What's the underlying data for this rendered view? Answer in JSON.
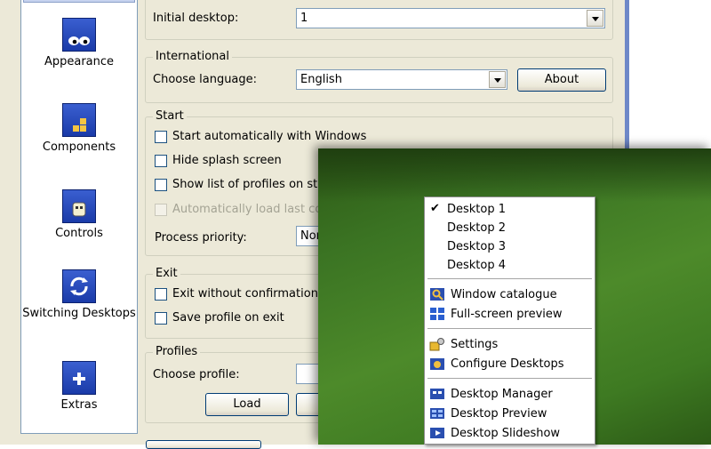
{
  "sidebar": {
    "items": [
      {
        "label": "Appearance",
        "icon": "appearance-icon"
      },
      {
        "label": "Components",
        "icon": "components-icon"
      },
      {
        "label": "Controls",
        "icon": "controls-icon"
      },
      {
        "label": "Switching Desktops",
        "icon": "switching-icon"
      },
      {
        "label": "Extras",
        "icon": "extras-icon"
      }
    ]
  },
  "desktop": {
    "initial_label": "Initial desktop:",
    "initial_value": "1"
  },
  "international": {
    "legend": "International",
    "language_label": "Choose language:",
    "language_value": "English",
    "about_button": "About"
  },
  "start": {
    "legend": "Start",
    "options": [
      {
        "label": "Start automatically with Windows",
        "checked": false,
        "enabled": true
      },
      {
        "label": "Hide splash screen",
        "checked": false,
        "enabled": true
      },
      {
        "label": "Show list of profiles on start",
        "checked": false,
        "enabled": true
      },
      {
        "label": "Automatically load last conf",
        "checked": false,
        "enabled": false
      }
    ],
    "priority_label": "Process priority:",
    "priority_value": "Nor"
  },
  "exit": {
    "legend": "Exit",
    "options": [
      {
        "label": "Exit without confirmation wi",
        "checked": false
      },
      {
        "label": "Save profile on exit",
        "checked": false
      }
    ]
  },
  "profiles": {
    "legend": "Profiles",
    "choose_label": "Choose profile:",
    "load_button": "Load"
  },
  "menu": {
    "desktops": [
      {
        "label": "Desktop 1",
        "checked": true
      },
      {
        "label": "Desktop 2",
        "checked": false
      },
      {
        "label": "Desktop 3",
        "checked": false
      },
      {
        "label": "Desktop 4",
        "checked": false
      }
    ],
    "group2": [
      {
        "label": "Window catalogue",
        "icon": "window-catalogue-icon"
      },
      {
        "label": "Full-screen preview",
        "icon": "fullscreen-preview-icon"
      }
    ],
    "group3": [
      {
        "label": "Settings",
        "icon": "settings-icon"
      },
      {
        "label": "Configure Desktops",
        "icon": "configure-desktops-icon"
      }
    ],
    "group4": [
      {
        "label": "Desktop Manager",
        "icon": "desktop-manager-icon"
      },
      {
        "label": "Desktop Preview",
        "icon": "desktop-preview-icon"
      },
      {
        "label": "Desktop Slideshow",
        "icon": "desktop-slideshow-icon"
      }
    ]
  },
  "colors": {
    "window_bg": "#ece9d8",
    "xp_blue": "#1a3ba8",
    "menu_bg": "#ffffff",
    "wallpaper_green": "#4d8a2a"
  }
}
